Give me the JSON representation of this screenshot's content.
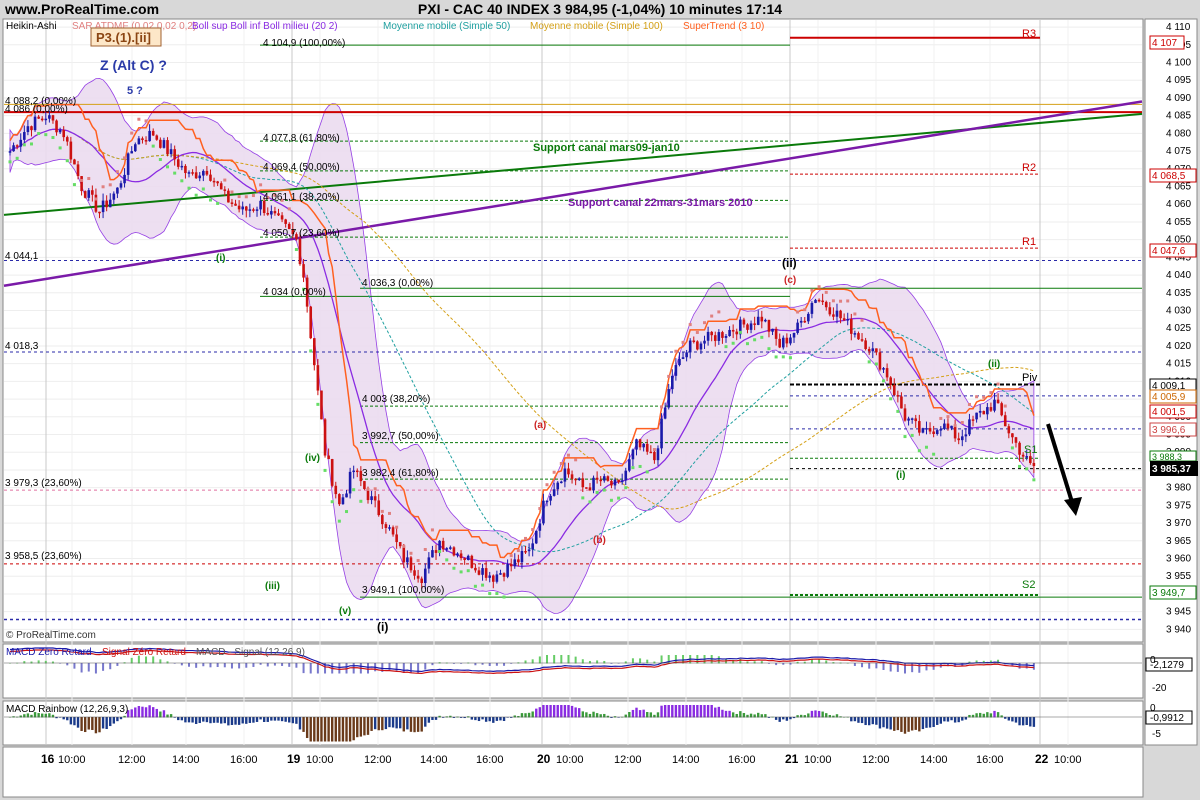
{
  "header": {
    "site": "www.ProRealTime.com",
    "title": "PXI - CAC 40 INDEX    3 984,95 (-1,04%)    10 minutes  17:14"
  },
  "indicators_legend": [
    {
      "label": "Heikin-Ashi",
      "color": "#000000"
    },
    {
      "label": "SAR ATDMF (0,02 0,02 0,2)",
      "color": "#e08080"
    },
    {
      "label": "Boll sup Boll inf Boll milieu (20 2)",
      "color": "#8a2be2"
    },
    {
      "label": "Moyenne mobile (Simple 50)",
      "color": "#20a0a0"
    },
    {
      "label": "Moyenne mobile (Simple 100)",
      "color": "#d4a017"
    },
    {
      "label": "SuperTrend (3 10)",
      "color": "#ff6020"
    }
  ],
  "copyright": "© ProRealTime.com",
  "wave_labels": {
    "box": "P3.(1).[ii]",
    "alt": "Z (Alt C) ?",
    "five": "5 ?",
    "i_small": "(i)",
    "iii": "(iii)",
    "iv": "(iv)",
    "v": "(v)",
    "i_big": "(i)",
    "a": "(a)",
    "b": "(b)",
    "ii_big": "(ii)",
    "c": "(c)",
    "i2": "(i)",
    "ii2": "(ii)"
  },
  "fib_labels": [
    "4 104,9 (100,00%)",
    "4 088,2 (0,00%)",
    "4 086 (0,00%)",
    "4 077,8 (61,80%)",
    "4 069,4 (50,00%)",
    "4 061,1 (38,20%)",
    "4 050,7 (23,60%)",
    "4 044,1",
    "4 036,3 (0,00%)",
    "4 034 (0,00%)",
    "4 018,3",
    "4 003 (38,20%)",
    "3 992,7 (50,00%)",
    "3 982,4 (61,80%)",
    "3 979,3 (23,60%)",
    "3 958,5 (23,60%)",
    "3 949,1 (100,00%)"
  ],
  "annotations": {
    "support1": "Support canal mars09-jan10",
    "support2": "Support canal 22mars-31mars 2010",
    "r3": "R3",
    "r2": "R2",
    "r1": "R1",
    "piv": "Piv",
    "s1": "S1",
    "s2": "S2"
  },
  "price_badges": [
    "4 107",
    "4 068,5",
    "4 047,6",
    "4 009,1",
    "4 005,9",
    "4 001,5",
    "3 996,6",
    "3 988,3",
    "3 985,37",
    "3 949,7"
  ],
  "macd": {
    "title_parts": [
      "MACD Zéro Retard",
      "Signal Zéro Retard",
      "MACD - Signal (12 26 9)"
    ],
    "value": "-2,1279",
    "ticks": [
      "0",
      "-20"
    ]
  },
  "rainbow": {
    "title": "MACD Rainbow (12,26,9,3)",
    "value": "-0,9912",
    "ticks": [
      "0",
      "-5"
    ]
  },
  "colors": {
    "bull": "#1a1aaa",
    "bear": "#cc1111",
    "boll_fill": "#ecdcf0",
    "boll_line": "#8a2be2",
    "supertrend": "#ff6020",
    "ma50": "#20a0a0",
    "ma100": "#d4a017"
  },
  "chart_data": [
    {
      "type": "candlestick",
      "series": "Heikin-Ashi CAC 40, 10 minutes",
      "ylim": [
        3937,
        4112
      ],
      "y_ticks": [
        3940,
        3945,
        3950,
        3955,
        3960,
        3965,
        3970,
        3975,
        3980,
        3985,
        3990,
        3995,
        4000,
        4005,
        4010,
        4015,
        4020,
        4025,
        4030,
        4035,
        4040,
        4045,
        4050,
        4055,
        4060,
        4065,
        4070,
        4075,
        4080,
        4085,
        4090,
        4095,
        4100,
        4105,
        4110
      ],
      "y_tick_labels": [
        "3 940",
        "3 945",
        "3 950",
        "3 955",
        "3 960",
        "3 965",
        "3 970",
        "3 975",
        "3 980",
        "3 985",
        "3 990",
        "3 995",
        "4 000",
        "4 005",
        "4 010",
        "4 015",
        "4 020",
        "4 025",
        "4 030",
        "4 035",
        "4 040",
        "4 045",
        "4 050",
        "4 055",
        "4 060",
        "4 065",
        "4 070",
        "4 075",
        "4 080",
        "4 085",
        "4 090",
        "4 095",
        "4 100",
        "4 105",
        "4 110"
      ],
      "x_tick_labels": [
        "16",
        "10:00",
        "12:00",
        "14:00",
        "16:00",
        "19",
        "10:00",
        "12:00",
        "14:00",
        "16:00",
        "20",
        "10:00",
        "12:00",
        "14:00",
        "16:00",
        "21",
        "10:00",
        "12:00",
        "14:00",
        "16:00",
        "22",
        "10:00"
      ],
      "close_path": [
        [
          0,
          4075
        ],
        [
          5,
          4082
        ],
        [
          10,
          4085
        ],
        [
          15,
          4080
        ],
        [
          20,
          4065
        ],
        [
          25,
          4058
        ],
        [
          30,
          4064
        ],
        [
          35,
          4078
        ],
        [
          40,
          4080
        ],
        [
          45,
          4074
        ],
        [
          50,
          4068
        ],
        [
          55,
          4070
        ],
        [
          60,
          4062
        ],
        [
          65,
          4058
        ],
        [
          70,
          4060
        ],
        [
          75,
          4055
        ],
        [
          80,
          4050
        ],
        [
          82,
          4040
        ],
        [
          85,
          4015
        ],
        [
          88,
          3990
        ],
        [
          92,
          3975
        ],
        [
          96,
          3985
        ],
        [
          100,
          3978
        ],
        [
          105,
          3970
        ],
        [
          110,
          3960
        ],
        [
          115,
          3955
        ],
        [
          120,
          3965
        ],
        [
          125,
          3962
        ],
        [
          130,
          3958
        ],
        [
          135,
          3955
        ],
        [
          140,
          3958
        ],
        [
          145,
          3962
        ],
        [
          150,
          3978
        ],
        [
          155,
          3985
        ],
        [
          160,
          3980
        ],
        [
          165,
          3982
        ],
        [
          170,
          3980
        ],
        [
          175,
          3992
        ],
        [
          180,
          3988
        ],
        [
          185,
          4012
        ],
        [
          190,
          4020
        ],
        [
          195,
          4022
        ],
        [
          200,
          4024
        ],
        [
          205,
          4026
        ],
        [
          210,
          4028
        ],
        [
          215,
          4020
        ],
        [
          220,
          4025
        ],
        [
          225,
          4034
        ],
        [
          230,
          4030
        ],
        [
          235,
          4025
        ],
        [
          240,
          4020
        ],
        [
          245,
          4012
        ],
        [
          250,
          4000
        ],
        [
          255,
          3995
        ],
        [
          260,
          3998
        ],
        [
          265,
          3994
        ],
        [
          270,
          4000
        ],
        [
          275,
          4004
        ],
        [
          280,
          3994
        ],
        [
          285,
          3986
        ]
      ],
      "bollinger_band": {
        "upper_peak": 4100,
        "lower_trough": 3940
      }
    },
    {
      "type": "bar",
      "series": "MACD Zéro Retard",
      "ylim": [
        -25,
        10
      ]
    },
    {
      "type": "bar",
      "series": "MACD Rainbow (12,26,9,3)",
      "ylim": [
        -6,
        2
      ]
    }
  ]
}
